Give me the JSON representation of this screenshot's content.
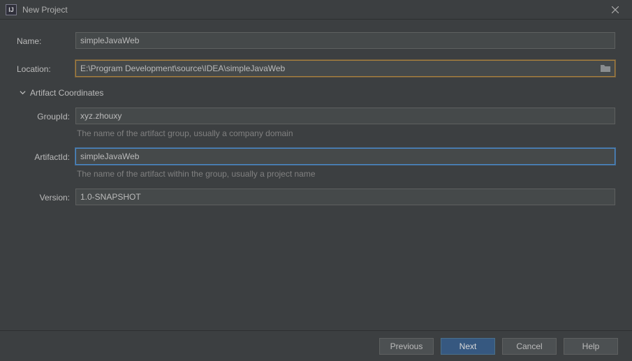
{
  "titlebar": {
    "app_icon_text": "IJ",
    "title": "New Project"
  },
  "form": {
    "name_label": "Name:",
    "name_value": "simpleJavaWeb",
    "location_label": "Location:",
    "location_value": "E:\\Program Development\\source\\IDEA\\simpleJavaWeb"
  },
  "artifact_section": {
    "header": "Artifact Coordinates",
    "groupid_label": "GroupId:",
    "groupid_value": "xyz.zhouxy",
    "groupid_hint": "The name of the artifact group, usually a company domain",
    "artifactid_label": "ArtifactId:",
    "artifactid_value": "simpleJavaWeb",
    "artifactid_hint": "The name of the artifact within the group, usually a project name",
    "version_label": "Version:",
    "version_value": "1.0-SNAPSHOT"
  },
  "buttons": {
    "previous": "Previous",
    "next": "Next",
    "cancel": "Cancel",
    "help": "Help"
  }
}
